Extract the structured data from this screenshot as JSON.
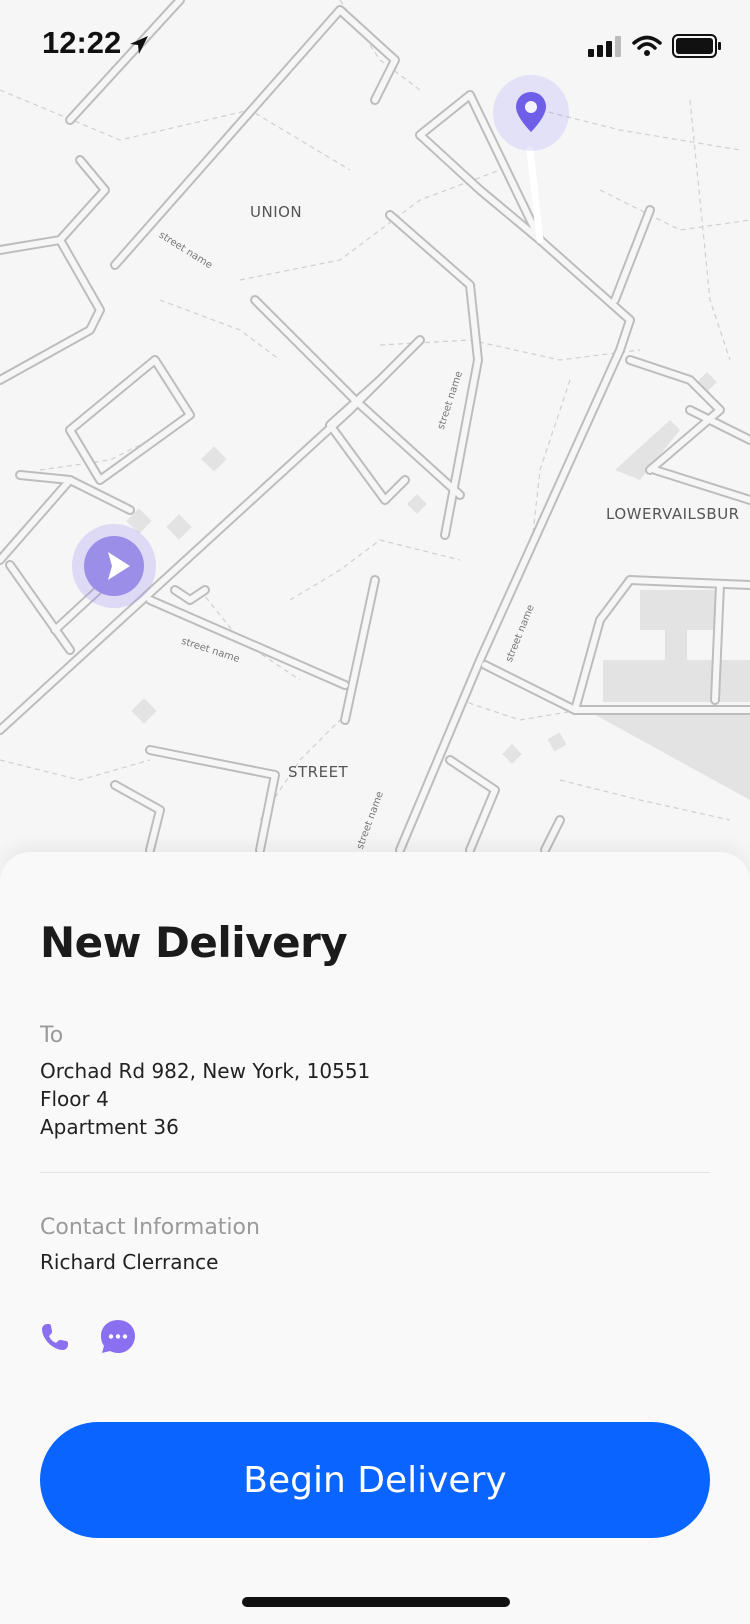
{
  "status_bar": {
    "time": "12:22",
    "icons": [
      "location-arrow-icon",
      "signal-icon",
      "wifi-icon",
      "battery-icon"
    ]
  },
  "map": {
    "area_labels": [
      "UNION",
      "LOWERVAILSBUR",
      "STREET"
    ],
    "street_label": "street name",
    "destination_pin": "location-pin-icon",
    "current_location": "navigation-arrow-icon",
    "accent": "#6f5ee8"
  },
  "delivery": {
    "title": "New Delivery",
    "to_label": "To",
    "address_line1": "Orchad Rd 982, New York, 10551",
    "address_line2": "Floor 4",
    "address_line3": "Apartment 36",
    "contact_label": "Contact Information",
    "contact_name": "Richard Clerrance",
    "phone_icon": "phone-icon",
    "chat_icon": "chat-bubble-icon",
    "cta_label": "Begin Delivery",
    "cta_color": "#0a64ff"
  }
}
